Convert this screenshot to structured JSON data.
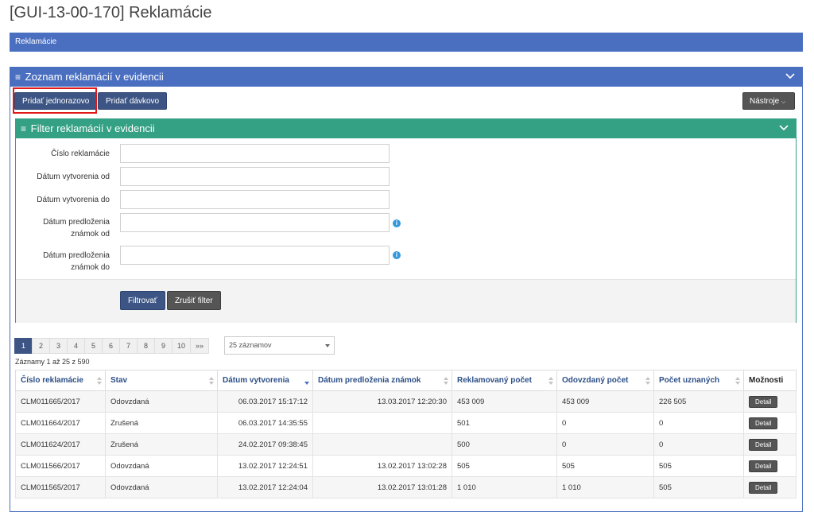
{
  "page": {
    "title": "[GUI-13-00-170] Reklamácie"
  },
  "breadcrumb": {
    "label": "Reklamácie"
  },
  "panel": {
    "title": "Zoznam reklamácií v evidencii"
  },
  "toolbar": {
    "add_single": "Pridať jednorazovo",
    "add_batch": "Pridať dávkovo",
    "tools": "Nástroje"
  },
  "filter": {
    "title": "Filter reklamácií v evidencii",
    "fields": [
      {
        "label": "Číslo reklamácie",
        "value": ""
      },
      {
        "label": "Dátum vytvorenia od",
        "value": ""
      },
      {
        "label": "Dátum vytvorenia do",
        "value": ""
      },
      {
        "label_line1": "Dátum predloženia",
        "label_line2": "známok od",
        "value": ""
      },
      {
        "label_line1": "Dátum predloženia",
        "label_line2": "známok do",
        "value": ""
      }
    ],
    "apply": "Filtrovať",
    "reset": "Zrušiť filter"
  },
  "pagination": {
    "pages": [
      "1",
      "2",
      "3",
      "4",
      "5",
      "6",
      "7",
      "8",
      "9",
      "10",
      "»»"
    ],
    "active": "1",
    "page_size": "25 záznamov"
  },
  "records_info": "Záznamy 1 až 25 z 590",
  "table": {
    "columns": [
      "Číslo reklamácie",
      "Stav",
      "Dátum vytvorenia",
      "Dátum predloženia známok",
      "Reklamovaný počet",
      "Odovzdaný počet",
      "Počet uznaných",
      "Možnosti"
    ],
    "rows": [
      [
        "CLM011665/2017",
        "Odovzdaná",
        "06.03.2017 15:17:12",
        "13.03.2017 12:20:30",
        "453 009",
        "453 009",
        "226 505",
        "Detail"
      ],
      [
        "CLM011664/2017",
        "Zrušená",
        "06.03.2017 14:35:55",
        "",
        "501",
        "0",
        "0",
        "Detail"
      ],
      [
        "CLM011624/2017",
        "Zrušená",
        "24.02.2017 09:38:45",
        "",
        "500",
        "0",
        "0",
        "Detail"
      ],
      [
        "CLM011566/2017",
        "Odovzdaná",
        "13.02.2017 12:24:51",
        "13.02.2017 13:02:28",
        "505",
        "505",
        "505",
        "Detail"
      ],
      [
        "CLM011565/2017",
        "Odovzdaná",
        "13.02.2017 12:24:04",
        "13.02.2017 13:01:28",
        "1 010",
        "1 010",
        "505",
        "Detail"
      ]
    ]
  },
  "colors": {
    "primary": "#4a6fc1",
    "filter": "#34a084",
    "button": "#3d5584",
    "highlight": "#e01a1a"
  }
}
